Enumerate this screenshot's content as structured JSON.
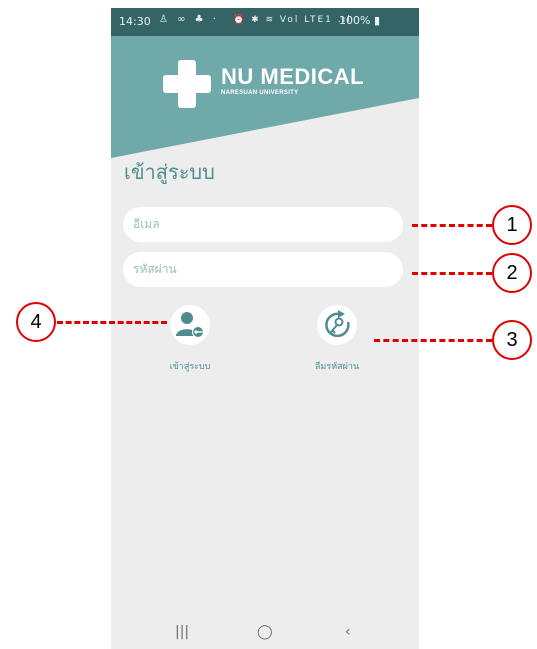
{
  "status_bar": {
    "time": "14:30",
    "notification_icons": "♙ ∞ ♣ ·",
    "system_icons": "⏰ ✱ ≋ Vol LTE1 .ıl",
    "battery": "100%"
  },
  "brand": {
    "name": "NU MEDICAL",
    "subtitle": "NARESUAN UNIVERSITY",
    "header_color": "#6fa9a9"
  },
  "page_title": "เข้าสู่ระบบ",
  "form": {
    "email_placeholder": "อีเมล",
    "password_placeholder": "รหัสผ่าน"
  },
  "actions": {
    "login_label": "เข้าสู่ระบบ",
    "forgot_label": "ลืมรหัสผ่าน"
  },
  "nav_bar": {
    "recents": "|||",
    "home": "◯",
    "back": "‹"
  },
  "annotations": {
    "marker_1": "1",
    "marker_2": "2",
    "marker_3": "3",
    "marker_4": "4",
    "color": "#e00000"
  }
}
